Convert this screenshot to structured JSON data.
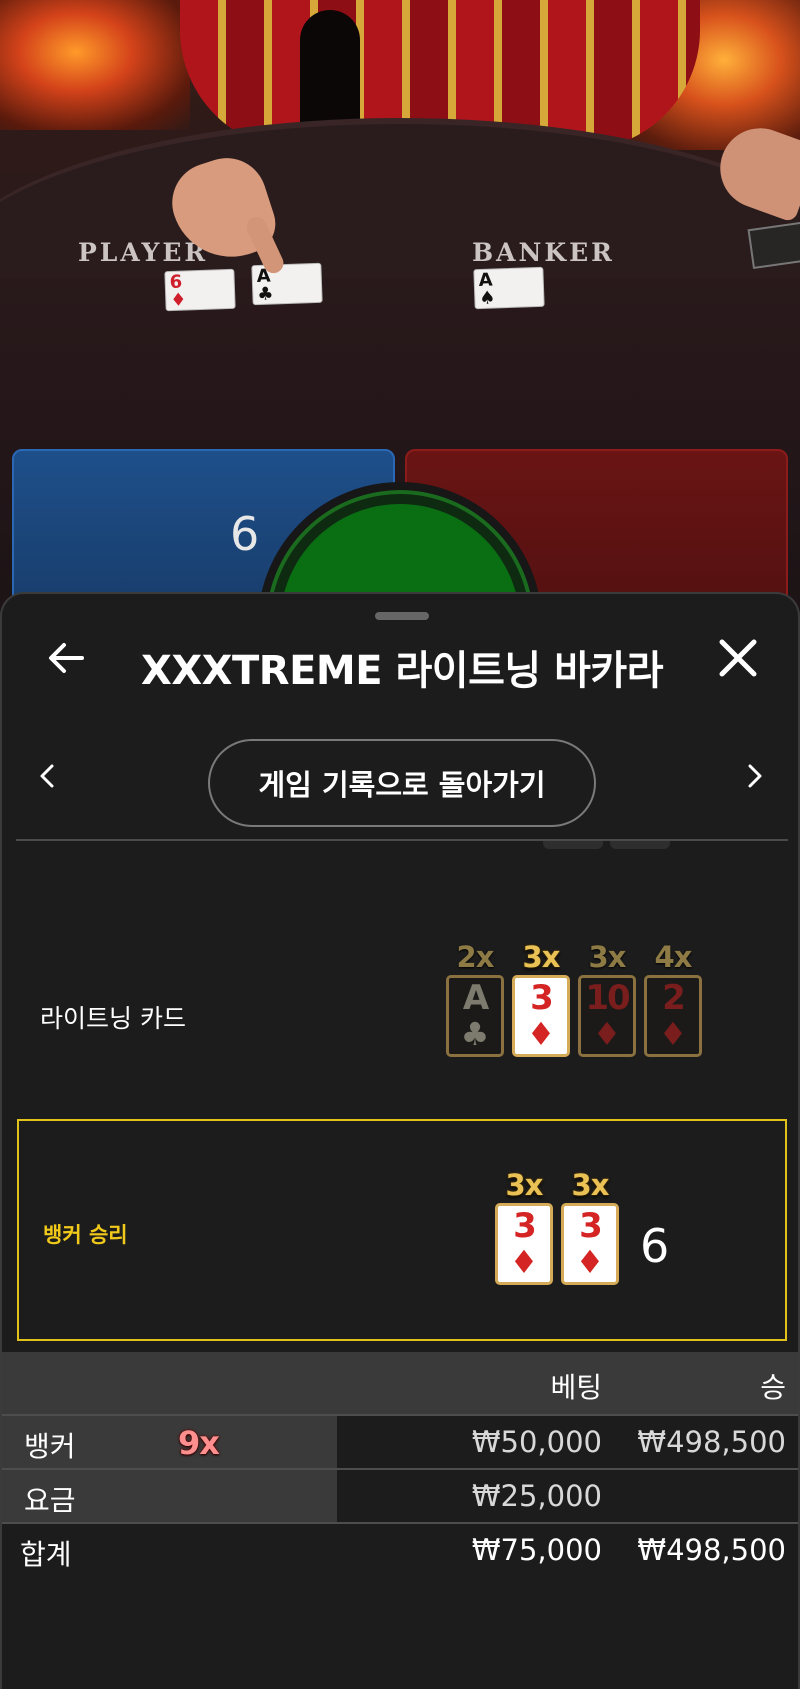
{
  "video": {
    "felt_player_label": "PLAYER",
    "felt_banker_label": "BANKER",
    "player_cards": [
      {
        "rank": "6",
        "suit": "♦"
      },
      {
        "rank": "A",
        "suit": "♣"
      }
    ],
    "banker_cards": [
      {
        "rank": "A",
        "suit": "♠"
      }
    ],
    "player_score": "6"
  },
  "sheet": {
    "title": "XXXTREME 라이트닝 바카라",
    "back_to_history_label": "게임 기록으로 돌아가기"
  },
  "lightning": {
    "label": "라이트닝 카드",
    "cards": [
      {
        "mult": "2x",
        "rank": "A",
        "suit": "♣",
        "color": "black",
        "active": false
      },
      {
        "mult": "3x",
        "rank": "3",
        "suit": "♦",
        "color": "red",
        "active": true
      },
      {
        "mult": "3x",
        "rank": "10",
        "suit": "♦",
        "color": "red",
        "active": false
      },
      {
        "mult": "4x",
        "rank": "2",
        "suit": "♦",
        "color": "red",
        "active": false
      }
    ]
  },
  "result": {
    "label": "뱅커 승리",
    "cards": [
      {
        "mult": "3x",
        "rank": "3",
        "suit": "♦"
      },
      {
        "mult": "3x",
        "rank": "3",
        "suit": "♦"
      }
    ],
    "score": "6"
  },
  "bets": {
    "col_bet": "베팅",
    "col_win": "승",
    "rows": [
      {
        "name": "뱅커",
        "multiplier": "9x",
        "bet": "₩50,000",
        "win": "₩498,500"
      },
      {
        "name": "요금",
        "bet": "₩25,000",
        "win": ""
      }
    ],
    "total": {
      "name": "합계",
      "bet": "₩75,000",
      "win": "₩498,500"
    }
  },
  "colors": {
    "accent_gold": "#e0c21a",
    "player_blue": "#1e4f8a",
    "banker_red": "#6a1414",
    "tie_green": "#0a6e13",
    "multiplier_red": "#ff8f8f"
  }
}
